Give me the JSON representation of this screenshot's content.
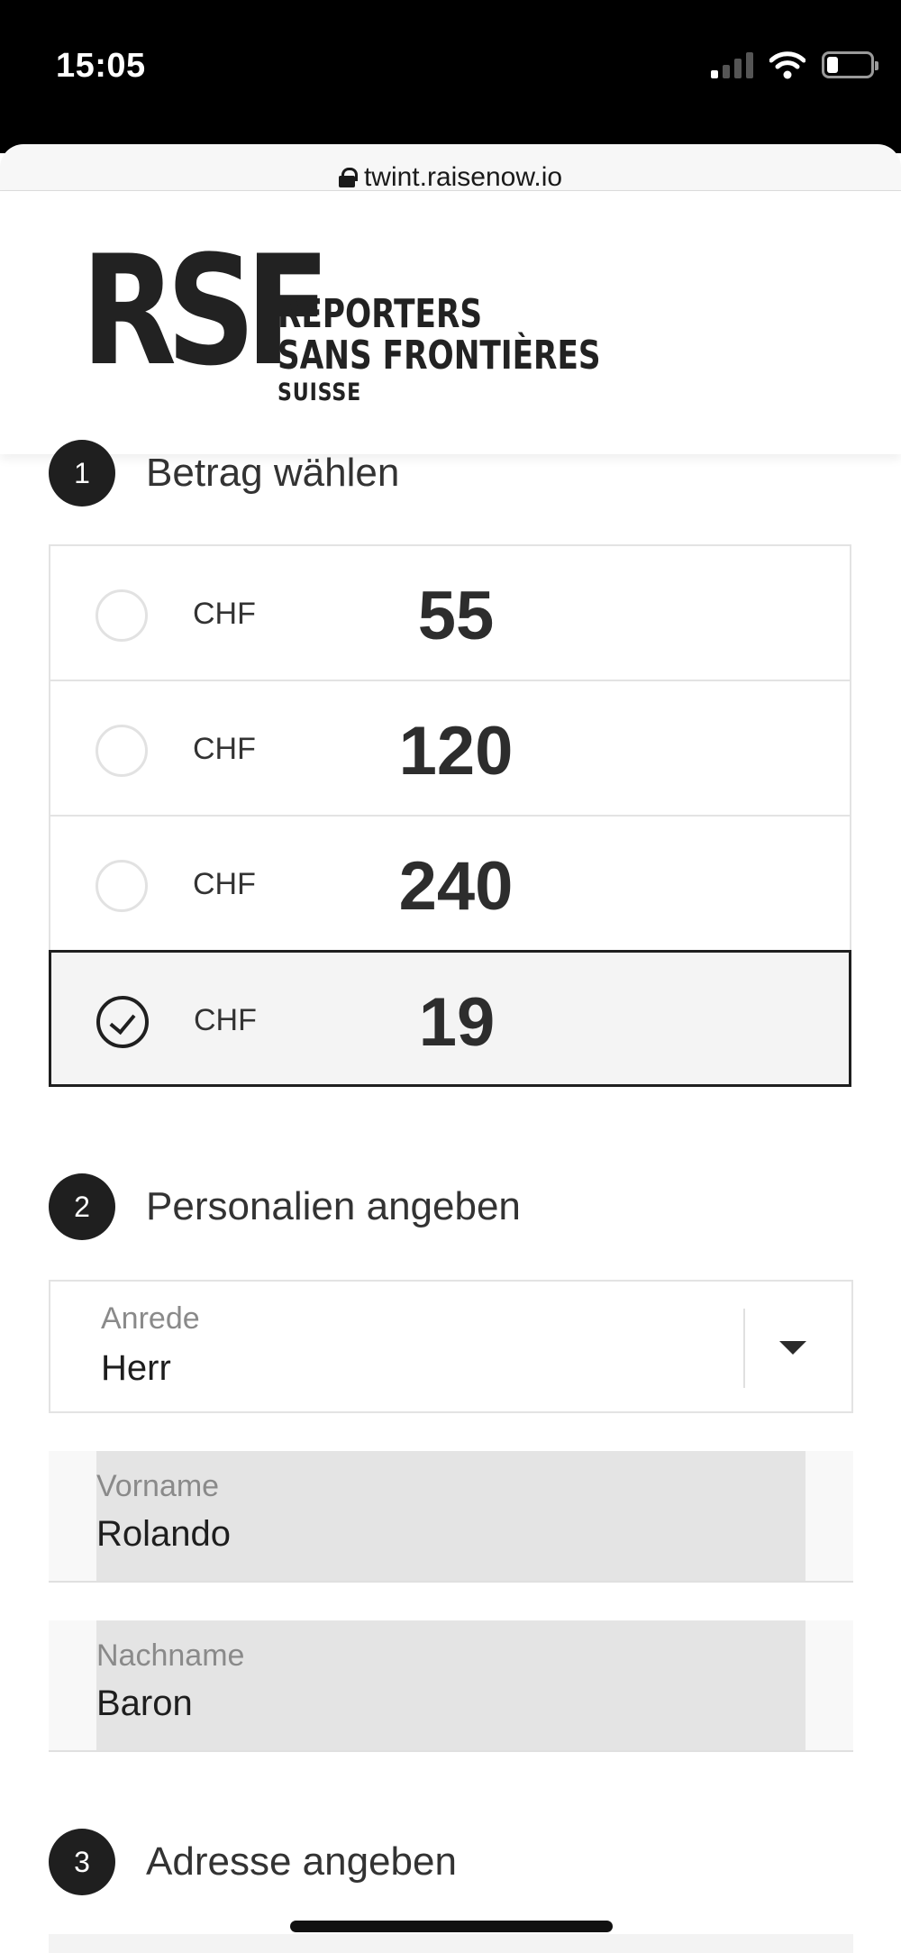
{
  "status_bar": {
    "time": "15:05"
  },
  "browser": {
    "url": "twint.raisenow.io"
  },
  "logo": {
    "mark": "RSF",
    "line1": "REPORTERS",
    "line2": "SANS FRONTIÈRES",
    "line3": "SUISSE"
  },
  "step1": {
    "number": "1",
    "title": "Betrag wählen",
    "options": [
      {
        "currency": "CHF",
        "value": "55",
        "selected": false
      },
      {
        "currency": "CHF",
        "value": "120",
        "selected": false
      },
      {
        "currency": "CHF",
        "value": "240",
        "selected": false
      },
      {
        "currency": "CHF",
        "value": "19",
        "selected": true
      }
    ]
  },
  "step2": {
    "number": "2",
    "title": "Personalien angeben",
    "salutation": {
      "label": "Anrede",
      "value": "Herr"
    },
    "first_name": {
      "label": "Vorname",
      "value": "Rolando"
    },
    "last_name": {
      "label": "Nachname",
      "value": "Baron"
    }
  },
  "step3": {
    "number": "3",
    "title": "Adresse angeben"
  }
}
